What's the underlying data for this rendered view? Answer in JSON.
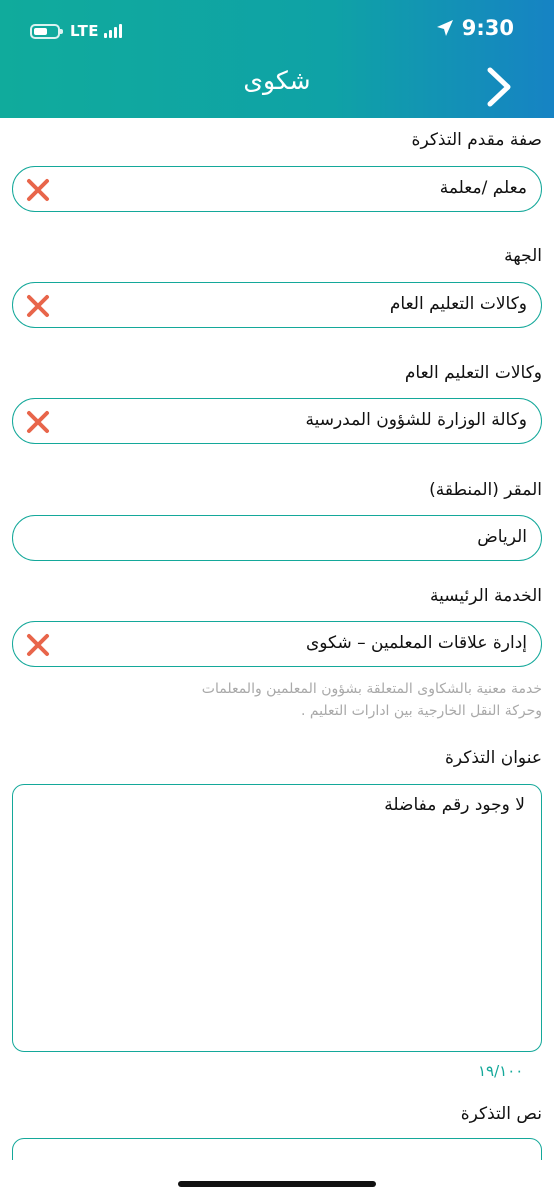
{
  "status_bar": {
    "carrier": "LTE",
    "time": "9:30"
  },
  "header": {
    "title": "شكوى",
    "back_icon": "chevron-right-icon"
  },
  "form": {
    "applicant_type": {
      "label": "صفة مقدم التذكرة",
      "value": "معلم /معلمة"
    },
    "entity": {
      "label": "الجهة",
      "value": "وكالات التعليم العام"
    },
    "agencies": {
      "label": "وكالات التعليم العام",
      "value": "وكالة الوزارة للشؤون المدرسية"
    },
    "region": {
      "label": "المقر (المنطقة)",
      "value": "الرياض"
    },
    "main_service": {
      "label": "الخدمة الرئيسية",
      "value": "إدارة علاقات المعلمين – شكوى",
      "description_line1": "خدمة معنية بالشكاوى المتعلقة بشؤون المعلمين والمعلمات",
      "description_line2": "وحركة النقل الخارجية بين ادارات التعليم ."
    },
    "ticket_title": {
      "label": "عنوان التذكرة",
      "value": "لا وجود رقم مفاضلة",
      "counter": "١٩/١٠٠"
    },
    "ticket_body": {
      "label": "نص التذكرة"
    }
  },
  "colors": {
    "accent": "#14a89a",
    "header_start": "#10ab9c",
    "header_end": "#1683c4",
    "clear_icon": "#e8654a",
    "hint_text": "#a9a9a9"
  }
}
